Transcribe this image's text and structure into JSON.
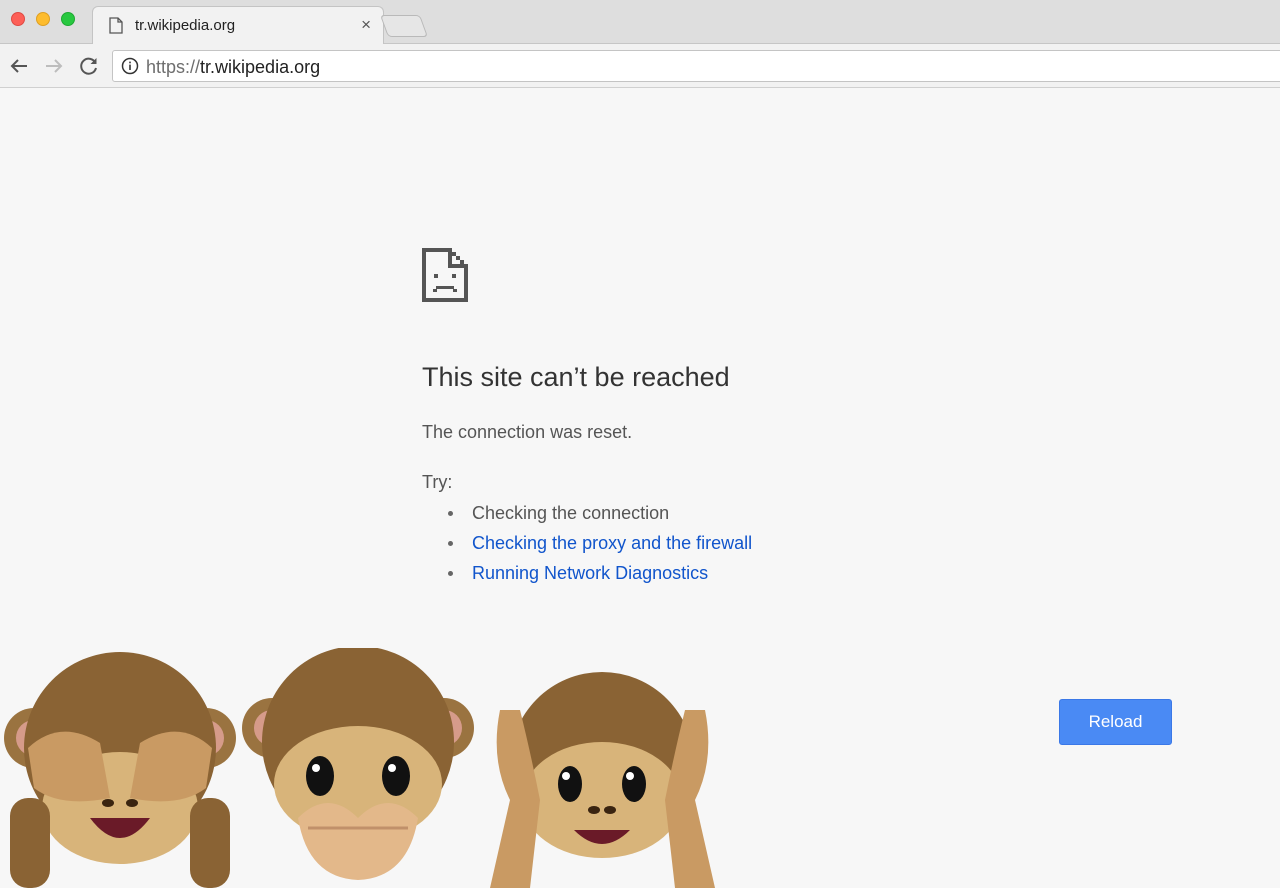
{
  "window": {
    "controls": [
      "close",
      "minimize",
      "zoom"
    ]
  },
  "tab": {
    "title": "tr.wikipedia.org",
    "favicon": "page-icon",
    "close_label": "×"
  },
  "toolbar": {
    "url_scheme": "https://",
    "url_host": "tr.wikipedia.org",
    "info_icon": "info-icon"
  },
  "error_page": {
    "icon": "sad-page-icon",
    "title": "This site can’t be reached",
    "message": "The connection was reset.",
    "try_label": "Try:",
    "suggestions": [
      {
        "text": "Checking the connection",
        "link": false
      },
      {
        "text": "Checking the proxy and the firewall",
        "link": true
      },
      {
        "text": "Running Network Diagnostics",
        "link": true
      }
    ],
    "reload_label": "Reload"
  },
  "overlay": {
    "stickers": [
      "see-no-evil-monkey",
      "speak-no-evil-monkey",
      "hear-no-evil-monkey"
    ]
  },
  "colors": {
    "link": "#1155cc",
    "reload_button": "#4a8af4",
    "page_background": "#f7f7f7"
  }
}
